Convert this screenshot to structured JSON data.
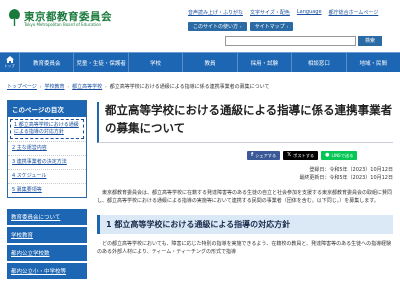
{
  "header": {
    "logo_ja": "東京都教育委員会",
    "logo_en": "Tokyo Metropolitan Board of Education",
    "util_links": [
      "音声読み上げ・ふりがな",
      "文字サイズ・配色",
      "Language",
      "都庁総合ホームページ"
    ],
    "util_buttons": [
      "このサイトの使い方",
      "サイトマップ"
    ],
    "search_label": "検索"
  },
  "nav": {
    "home_label": "トップ",
    "items": [
      "教育委員会",
      "児童・生徒・保護者",
      "学校",
      "教員",
      "採用・試験",
      "相談窓口",
      "地域・民間"
    ]
  },
  "breadcrumb": [
    "トップページ",
    "学校教育",
    "都立高等学校",
    "都立高等学校における通級による指導に係る連携事業者の募集について"
  ],
  "sidebar": {
    "toc_title": "このページの目次",
    "toc_items": [
      "1 都立高等学校における通級による指導の対応方針",
      "2 主な運営内容",
      "3 連携事業者の決定方法",
      "4 スケジュール",
      "5 募集要項等"
    ],
    "nav_items": [
      "教育委員会について",
      "学校教育",
      "都内公立学校数",
      "都内公立小・中学校等"
    ]
  },
  "main": {
    "title": "都立高等学校における通級による指導に係る連携事業者の募集について",
    "share": {
      "facebook": "シェアする",
      "x": "ポストする",
      "line": "LINEで送る"
    },
    "registered": "登録日：令和5年（2023）10月12日",
    "updated": "最終更新日：令和5年（2023）10月12日",
    "body": "東京都教育委員会は、都立高等学校に在籍する発達障害等のある生徒の自立と社会参加を支援する東京都教育委員会の取組に賛同し、都立高等学校における通級による指導の実施等において連携する民間の事業者（団体を含む。以下同じ。）を募集します。",
    "section1_title": "1 都立高等学校における通級による指導の対応方針",
    "section1_body": "どの都立高等学校においても、障害に応じた特別の指導を実施できるよう、在籍校の教員と、発達障害等のある生徒への指導経験のある外部人材により、ティーム・ティーチングの形式で指導"
  },
  "colors": {
    "brand_green": "#1a7a3c",
    "nav_blue": "#1d66b3",
    "link_blue": "#1a4fa0"
  }
}
